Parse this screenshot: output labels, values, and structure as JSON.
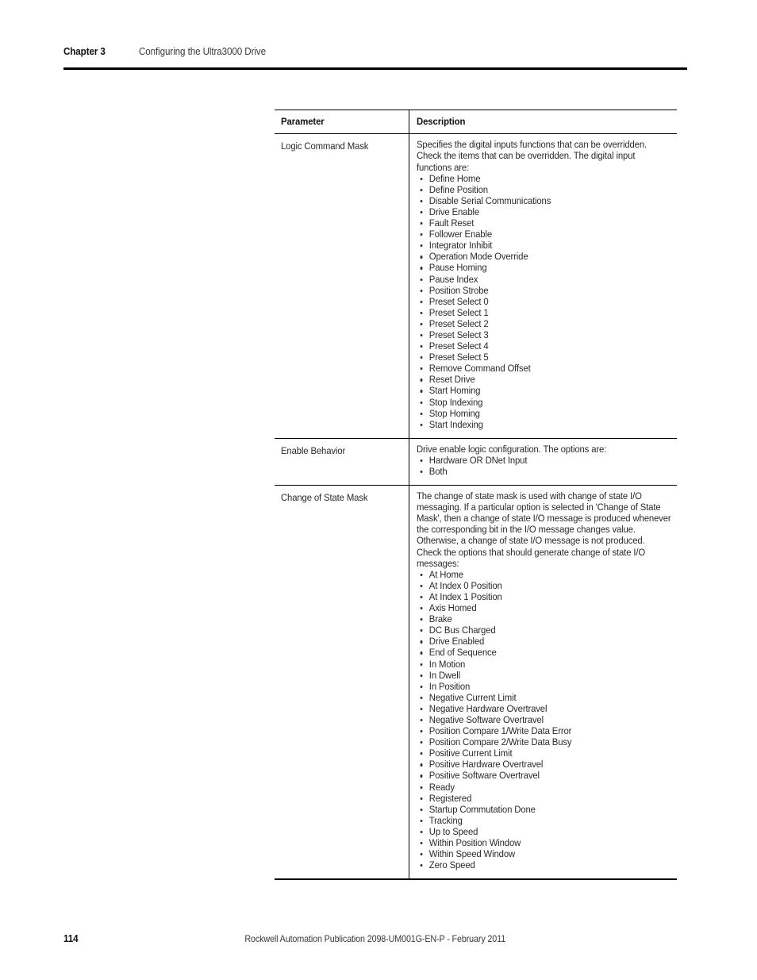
{
  "header": {
    "chapter_label": "Chapter 3",
    "chapter_title": "Configuring the Ultra3000 Drive"
  },
  "table": {
    "columns": {
      "parameter": "Parameter",
      "description": "Description"
    },
    "rows": [
      {
        "parameter": "Logic Command Mask",
        "description": "Specifies the digital inputs functions that can be overridden. Check the items that can be overridden. The digital input functions are:",
        "bullets": [
          "Define Home",
          "Define Position",
          "Disable Serial Communications",
          "Drive Enable",
          "Fault Reset",
          "Follower Enable",
          "Integrator Inhibit",
          "Operation Mode Override",
          "Pause Homing",
          "Pause Index",
          "Position Strobe",
          "Preset Select 0",
          "Preset Select 1",
          "Preset Select 2",
          "Preset Select 3",
          "Preset Select 4",
          "Preset Select 5",
          "Remove Command Offset",
          "Reset Drive",
          "Start Homing",
          "Stop Indexing",
          "Stop Homing",
          "Start Indexing"
        ]
      },
      {
        "parameter": "Enable Behavior",
        "description": "Drive enable logic configuration. The options are:",
        "bullets": [
          "Hardware OR DNet Input",
          "Both"
        ]
      },
      {
        "parameter": "Change of State Mask",
        "description": "The change of state mask is used with change of state I/O messaging. If a particular option is selected in 'Change of State Mask', then a change of state I/O message is produced whenever the corresponding bit in the I/O message changes value. Otherwise, a change of state I/O message is not produced. Check the options that should generate change of state I/O messages:",
        "bullets": [
          "At Home",
          "At Index 0 Position",
          "At Index 1 Position",
          "Axis Homed",
          "Brake",
          "DC Bus Charged",
          "Drive Enabled",
          "End of Sequence",
          "In Motion",
          "In Dwell",
          "In Position",
          "Negative Current Limit",
          "Negative Hardware Overtravel",
          "Negative Software Overtravel",
          "Position Compare 1/Write Data Error",
          "Position Compare 2/Write Data Busy",
          "Positive Current Limit",
          "Positive Hardware Overtravel",
          "Positive Software Overtravel",
          "Ready",
          "Registered",
          "Startup Commutation Done",
          "Tracking",
          "Up to Speed",
          "Within Position Window",
          "Within Speed Window",
          "Zero Speed"
        ]
      }
    ]
  },
  "footer": {
    "page_number": "114",
    "publication": "Rockwell Automation Publication 2098-UM001G-EN-P  -  February 2011"
  }
}
